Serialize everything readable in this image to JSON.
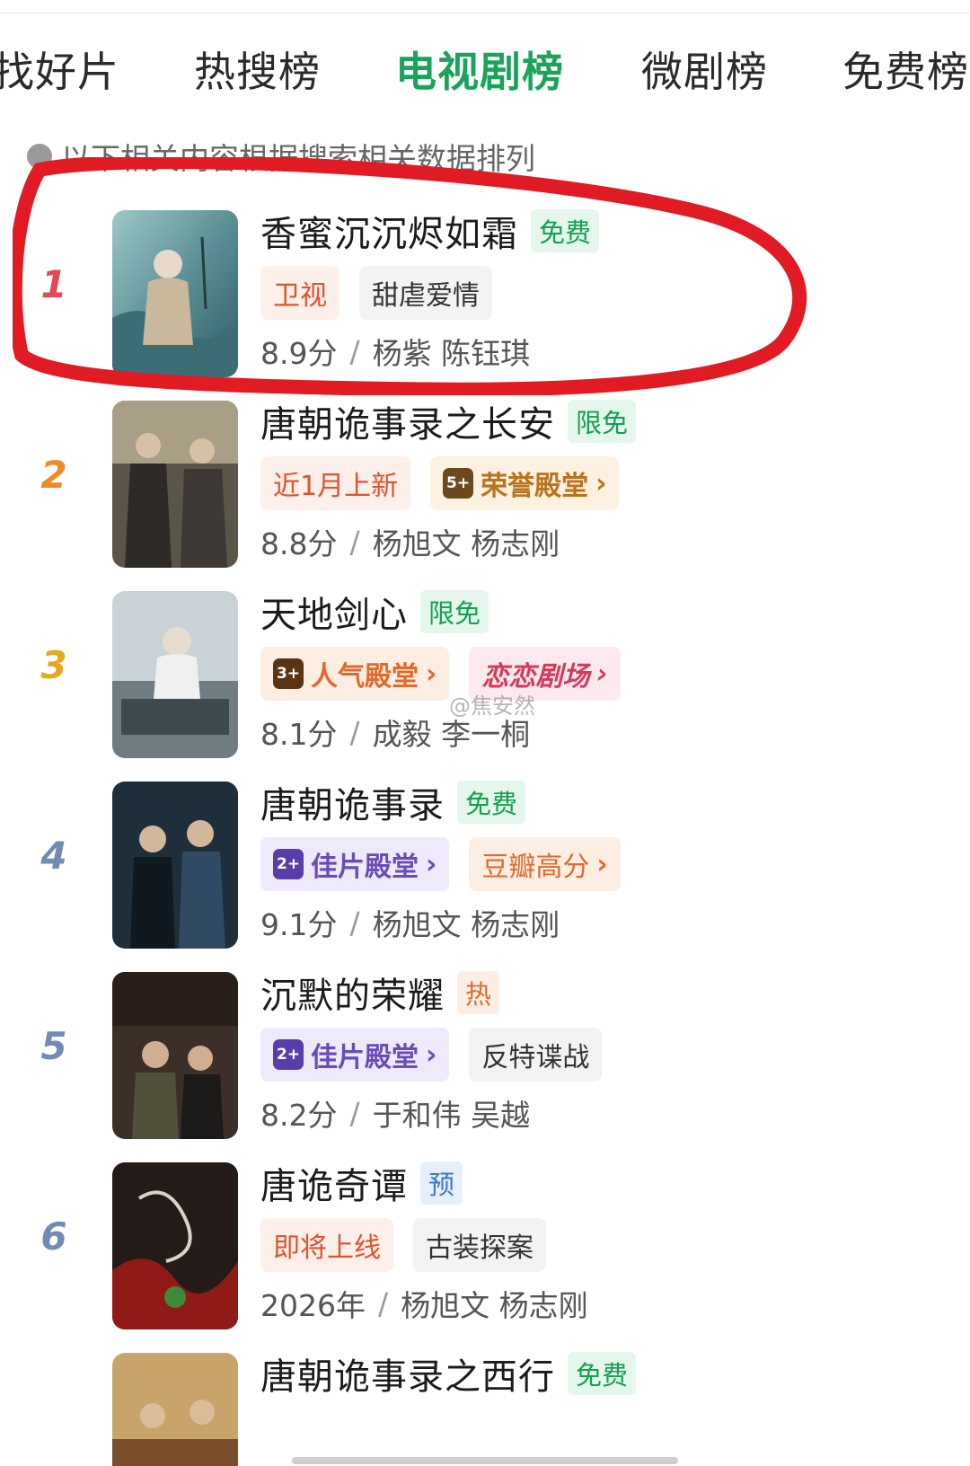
{
  "tabs": [
    {
      "label": "找好片",
      "active": false
    },
    {
      "label": "热搜榜",
      "active": false
    },
    {
      "label": "电视剧榜",
      "active": true
    },
    {
      "label": "微剧榜",
      "active": false
    },
    {
      "label": "免费榜",
      "active": false
    }
  ],
  "notice": {
    "text": "以下相关内容根据搜索相关数据排列",
    "icon": "info-icon"
  },
  "watermark": "@焦安然",
  "colors": {
    "accent": "#1aa35a",
    "highlight": "#e01b24",
    "rank1": "#e34a55",
    "rank2": "#f08a24",
    "rank3": "#e8a81e",
    "rank_other": "#6f8bb6"
  },
  "items": [
    {
      "rank": "1",
      "title": "香蜜沉沉烬如霜",
      "flag": "免费",
      "tags": [
        {
          "text": "卫视"
        },
        {
          "text": "甜虐爱情"
        }
      ],
      "score": "8.9分",
      "sep": "/",
      "cast": "杨紫 陈钰琪"
    },
    {
      "rank": "2",
      "title": "唐朝诡事录之长安",
      "flag": "限免",
      "tags": [
        {
          "text": "近1月上新"
        },
        {
          "badge": "5+",
          "text": "荣誉殿堂",
          "chevron": "›"
        }
      ],
      "score": "8.8分",
      "sep": "/",
      "cast": "杨旭文 杨志刚"
    },
    {
      "rank": "3",
      "title": "天地剑心",
      "flag": "限免",
      "tags": [
        {
          "badge": "3+",
          "text": "人气殿堂",
          "chevron": "›"
        },
        {
          "text": "恋恋剧场",
          "chevron": "›"
        }
      ],
      "score": "8.1分",
      "sep": "/",
      "cast": "成毅 李一桐"
    },
    {
      "rank": "4",
      "title": "唐朝诡事录",
      "flag": "免费",
      "tags": [
        {
          "badge": "2+",
          "text": "佳片殿堂",
          "chevron": "›"
        },
        {
          "text": "豆瓣高分",
          "chevron": "›"
        }
      ],
      "score": "9.1分",
      "sep": "/",
      "cast": "杨旭文 杨志刚"
    },
    {
      "rank": "5",
      "title": "沉默的荣耀",
      "flag": "热",
      "tags": [
        {
          "badge": "2+",
          "text": "佳片殿堂",
          "chevron": "›"
        },
        {
          "text": "反特谍战"
        }
      ],
      "score": "8.2分",
      "sep": "/",
      "cast": "于和伟 吴越"
    },
    {
      "rank": "6",
      "title": "唐诡奇谭",
      "flag": "预",
      "tags": [
        {
          "text": "即将上线"
        },
        {
          "text": "古装探案"
        }
      ],
      "score": "2026年",
      "sep": "/",
      "cast": "杨旭文 杨志刚"
    },
    {
      "rank": "",
      "title": "唐朝诡事录之西行",
      "flag": "免费"
    }
  ]
}
